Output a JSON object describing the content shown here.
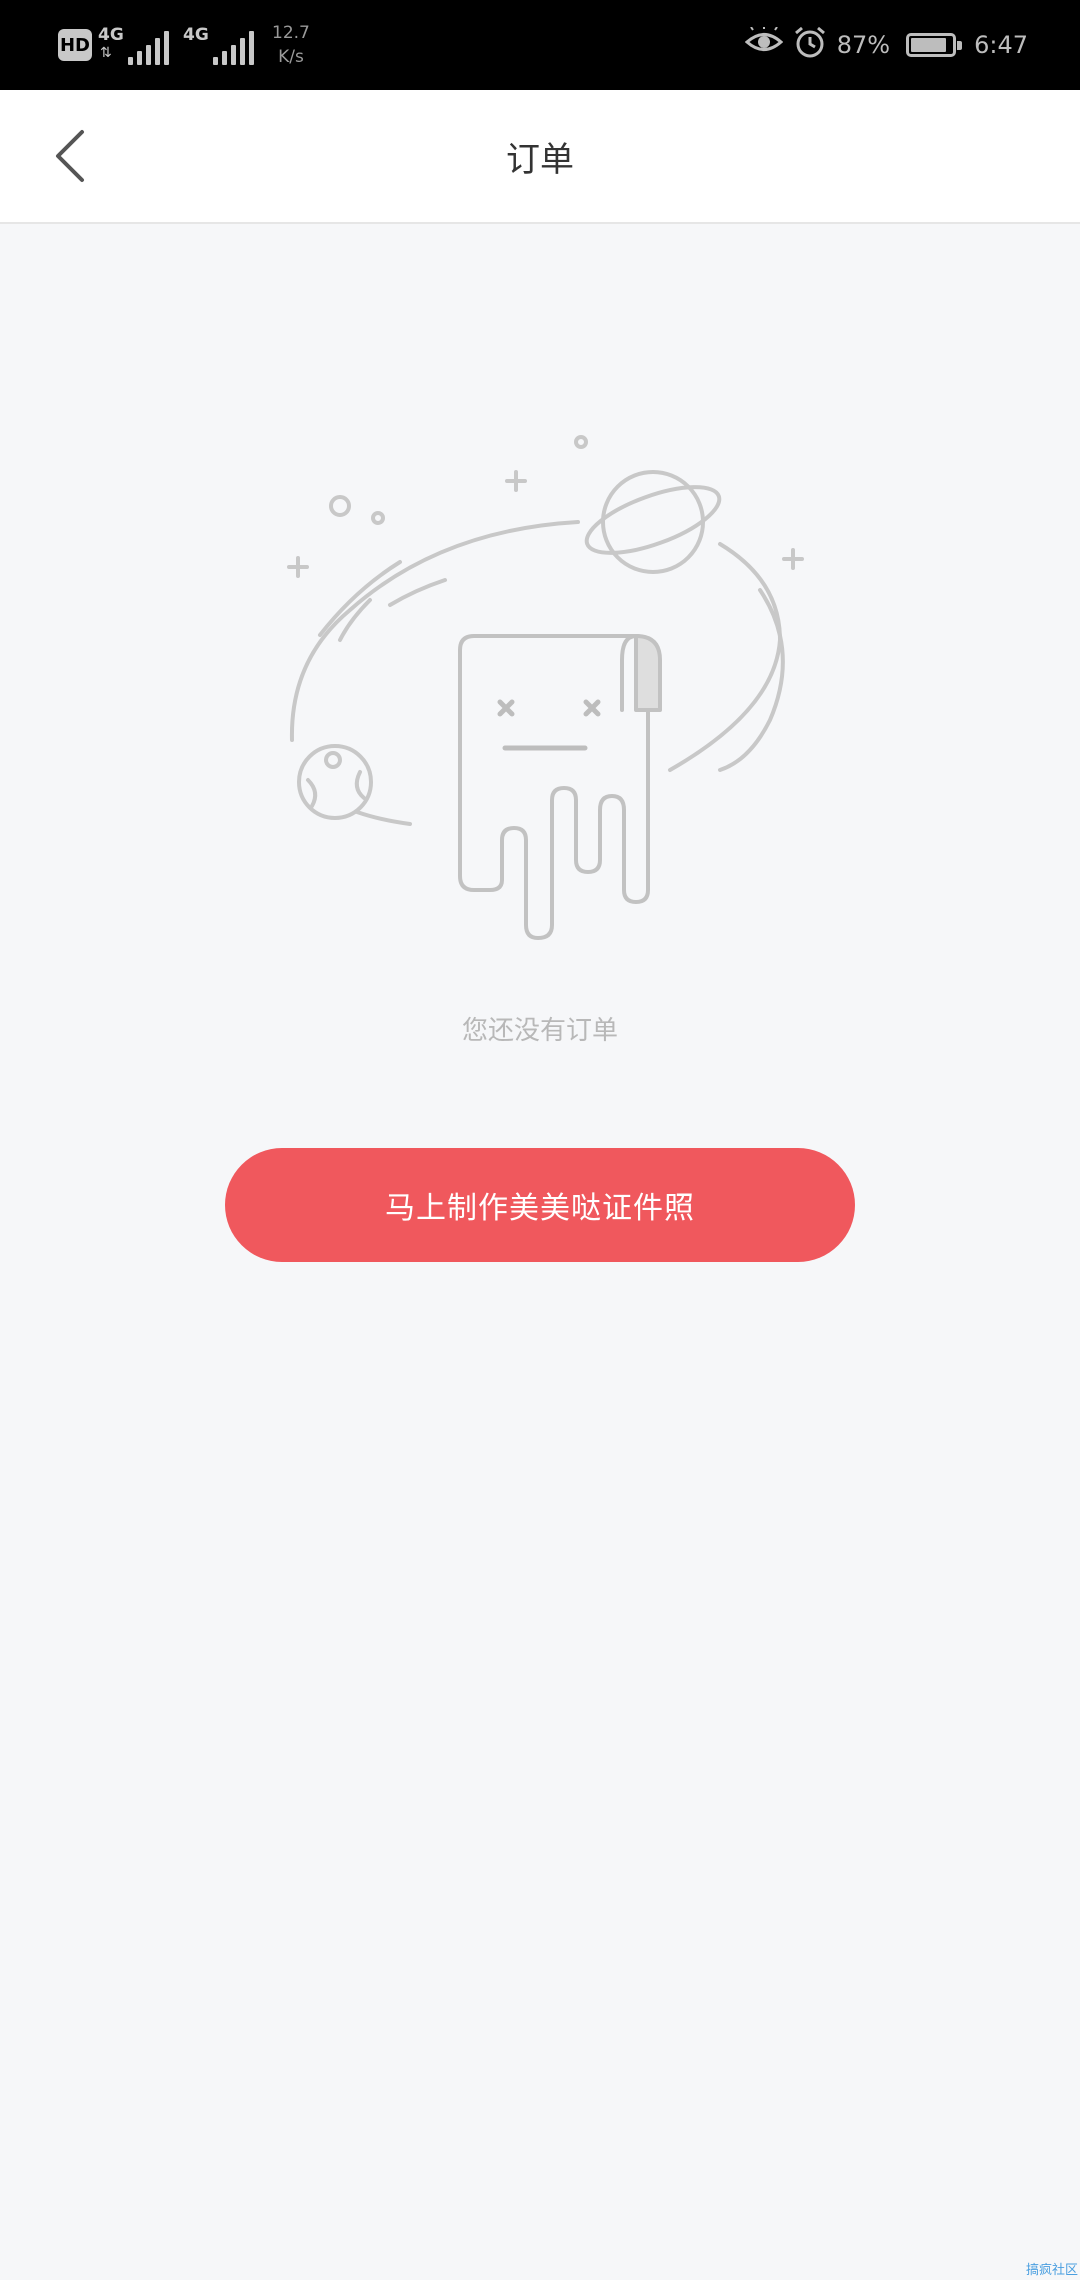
{
  "status_bar": {
    "hd": "HD",
    "net1": "4G",
    "net2": "4G",
    "speed_value": "12.7",
    "speed_unit": "K/s",
    "battery_percent": "87%",
    "battery_level": 0.87,
    "time": "6:47",
    "icons": [
      "eye-icon",
      "alarm-icon",
      "battery-icon",
      "signal-icon"
    ]
  },
  "header": {
    "title": "订单",
    "back_icon": "chevron-left-icon"
  },
  "empty_state": {
    "illustration": "empty-orders-illustration",
    "message": "您还没有订单"
  },
  "cta": {
    "label": "马上制作美美哒证件照",
    "color": "#f0585d"
  },
  "watermark": "搞疯社区",
  "colors": {
    "background": "#f6f7f9",
    "accent": "#f0585d",
    "muted_text": "#b8b8b8"
  }
}
